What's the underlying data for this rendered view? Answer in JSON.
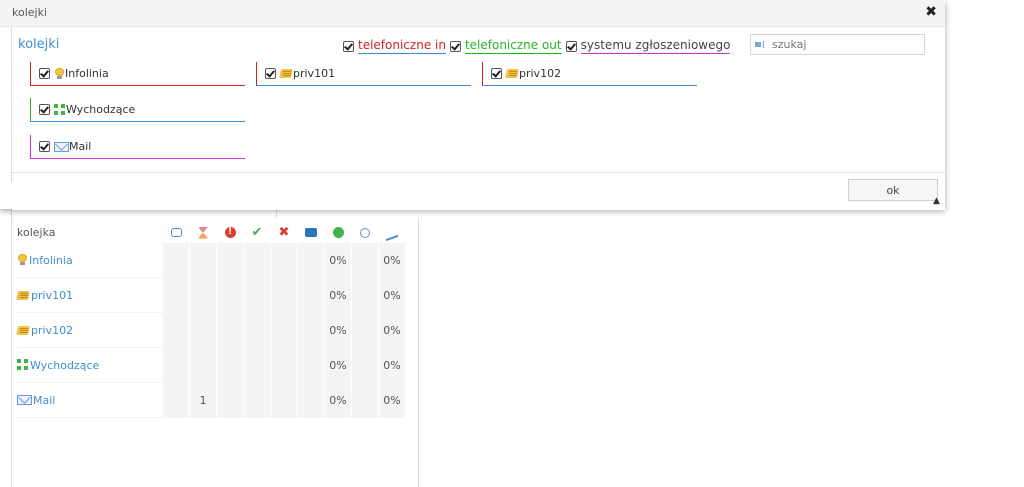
{
  "modal": {
    "title": "kolejki",
    "close_icon": "close-x",
    "section_title": "kolejki",
    "filters": [
      {
        "label": "telefoniczne in",
        "checked": true,
        "color": "#d81f2a"
      },
      {
        "label": "telefoniczne out",
        "checked": true,
        "color": "#28b428"
      },
      {
        "label": "systemu zgłoszeniowego",
        "checked": true,
        "color": "#444444"
      }
    ],
    "search": {
      "placeholder": "szukaj",
      "value": ""
    },
    "queue_boxes": [
      {
        "label": "Infolinia",
        "icon": "lightbulb-icon",
        "checked": true
      },
      {
        "label": "priv101",
        "icon": "hand-icon",
        "checked": true
      },
      {
        "label": "priv102",
        "icon": "hand-icon",
        "checked": true
      },
      {
        "label": "Wychodzące",
        "icon": "arrows-out-icon",
        "checked": true
      },
      {
        "label": "Mail",
        "icon": "mail-icon",
        "checked": true
      }
    ],
    "ok_label": "ok"
  },
  "table": {
    "header": {
      "name": "kolejka",
      "icons": [
        "comment-icon",
        "hourglass-icon",
        "alert-icon",
        "check-icon",
        "cross-icon",
        "phone-icon",
        "ok-circle-icon",
        "clock-icon",
        "chart-icon"
      ]
    },
    "rows": [
      {
        "name": "Infolinia",
        "icon": "lightbulb-icon",
        "cells": [
          "",
          "",
          "",
          "",
          "",
          "",
          "0%",
          "",
          "0%"
        ]
      },
      {
        "name": "priv101",
        "icon": "hand-icon",
        "cells": [
          "",
          "",
          "",
          "",
          "",
          "",
          "0%",
          "",
          "0%"
        ]
      },
      {
        "name": "priv102",
        "icon": "hand-icon",
        "cells": [
          "",
          "",
          "",
          "",
          "",
          "",
          "0%",
          "",
          "0%"
        ]
      },
      {
        "name": "Wychodzące",
        "icon": "arrows-out-icon",
        "cells": [
          "",
          "",
          "",
          "",
          "",
          "",
          "0%",
          "",
          "0%"
        ]
      },
      {
        "name": "Mail",
        "icon": "mail-icon",
        "cells": [
          "",
          "1",
          "",
          "",
          "",
          "",
          "0%",
          "",
          "0%"
        ]
      }
    ]
  },
  "colors": {
    "accent": "#3e8ed0",
    "red": "#d81f2a",
    "green": "#28b428",
    "purple": "#cc33cc"
  }
}
